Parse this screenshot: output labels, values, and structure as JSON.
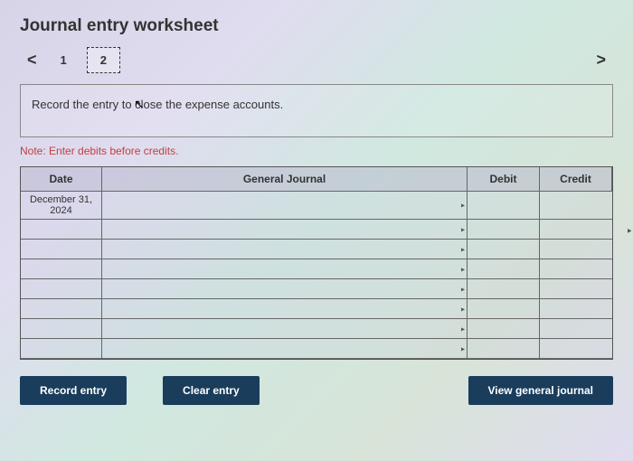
{
  "title": "Journal entry worksheet",
  "nav": {
    "prev": "<",
    "next": ">"
  },
  "tabs": [
    {
      "label": "1",
      "active": false
    },
    {
      "label": "2",
      "active": true
    }
  ],
  "instruction": "Record the entry to close the expense accounts.",
  "note": "Note: Enter debits before credits.",
  "table": {
    "headers": {
      "date": "Date",
      "journal": "General Journal",
      "debit": "Debit",
      "credit": "Credit"
    },
    "rows": [
      {
        "date": "December 31, 2024",
        "journal": "",
        "debit": "",
        "credit": ""
      },
      {
        "date": "",
        "journal": "",
        "debit": "",
        "credit": ""
      },
      {
        "date": "",
        "journal": "",
        "debit": "",
        "credit": ""
      },
      {
        "date": "",
        "journal": "",
        "debit": "",
        "credit": ""
      },
      {
        "date": "",
        "journal": "",
        "debit": "",
        "credit": ""
      },
      {
        "date": "",
        "journal": "",
        "debit": "",
        "credit": ""
      },
      {
        "date": "",
        "journal": "",
        "debit": "",
        "credit": ""
      },
      {
        "date": "",
        "journal": "",
        "debit": "",
        "credit": ""
      }
    ]
  },
  "buttons": {
    "record": "Record entry",
    "clear": "Clear entry",
    "view": "View general journal"
  }
}
